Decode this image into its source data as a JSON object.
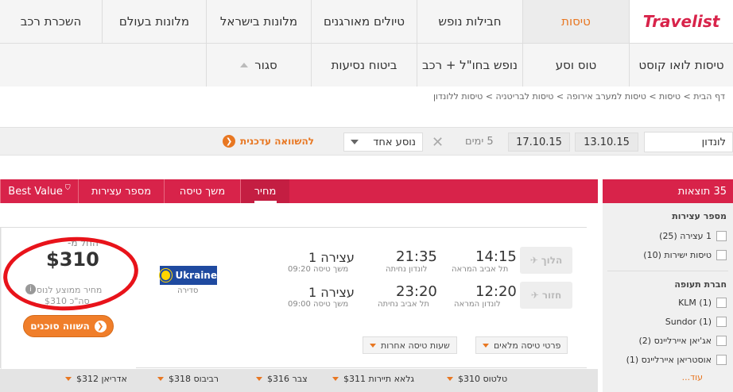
{
  "nav": {
    "logo": "Travelist",
    "row1": [
      "טיסות",
      "חבילות נופש",
      "טיולים מאורגנים",
      "מלונות בישראל",
      "מלונות בעולם",
      "השכרת רכב"
    ],
    "row2": [
      "טיסות לואו קוסט",
      "טוס וסע",
      "נופש בחו\"ל + רכב",
      "ביטוח נסיעות",
      "סגור"
    ]
  },
  "breadcrumb": "דף הבית > טיסות > טיסות למערב אירופה > טיסות לבריטניה > טיסות ללונדון",
  "search": {
    "destination": "לונדון",
    "date_out": "13.10.15",
    "date_back": "17.10.15",
    "days": "5 ימים",
    "passengers": "נוסע אחד",
    "compare_link": "להשוואה עדכנית"
  },
  "sidebar": {
    "results": "35 תוצאות",
    "stops_title": "מספר עצירות",
    "stops": [
      "1 עצירה (25)",
      "טיסות ישירות (10)"
    ],
    "airline_title": "חברת תעופה",
    "airlines": [
      "KLM (1)",
      "Sundor (1)",
      "אג'יאן איירליינס (2)",
      "אוסטריאן איירליינס (1)"
    ],
    "more": "עוד..."
  },
  "tabs": {
    "price": "מחיר",
    "duration": "משך טיסה",
    "stops": "מספר עצירות",
    "best": "Best Value"
  },
  "result": {
    "from_label": "החל מ-",
    "price": "$310",
    "price_note1": "מחיר ממוצע לנוסע",
    "price_note2": "סה\"כ $310",
    "compare_btn": "השווה סוכנים",
    "airline": "Ukraine",
    "airline_sub": "סדירה",
    "outbound": {
      "label": "הלוך",
      "dep_time": "14:15",
      "dep_place": "תל אביב המראה",
      "arr_time": "21:35",
      "arr_place": "לונדון נחיתה",
      "stops": "עצירה 1",
      "duration": "משך טיסה 09:20"
    },
    "inbound": {
      "label": "חזור",
      "dep_time": "12:20",
      "dep_place": "לונדון המראה",
      "arr_time": "23:20",
      "arr_place": "תל אביב נחיתה",
      "stops": "עצירה 1",
      "duration": "משך טיסה 09:00"
    },
    "details_btn": "פרטי טיסה מלאים",
    "other_times_btn": "שעות טיסה אחרות"
  },
  "agents": [
    "טלטוס $310",
    "גלאא תיירות $311",
    "צבר $316",
    "רביבוס $318",
    "אדריאן $312"
  ]
}
